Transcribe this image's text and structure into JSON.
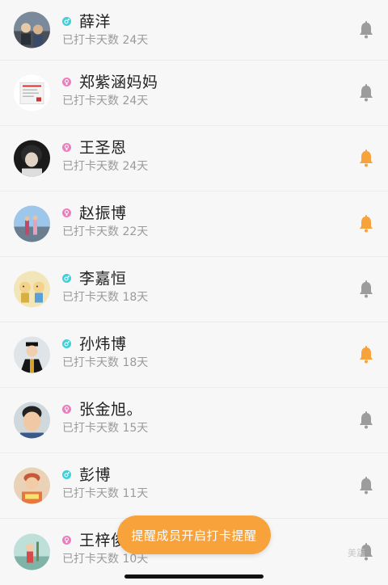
{
  "colors": {
    "accent": "#f7a23a",
    "bell_active": "#f7a23a",
    "bell_inactive": "#9c9c9c",
    "gender_male": "#3fd0d9",
    "gender_female": "#ee7dc0"
  },
  "members": [
    {
      "name": "薛洋",
      "days": "已打卡天数 24天",
      "gender": "male",
      "bell": "inactive"
    },
    {
      "name": "郑紫涵妈妈",
      "days": "已打卡天数 24天",
      "gender": "female",
      "bell": "inactive"
    },
    {
      "name": "王圣恩",
      "days": "已打卡天数 24天",
      "gender": "female",
      "bell": "active"
    },
    {
      "name": "赵振博",
      "days": "已打卡天数 22天",
      "gender": "female",
      "bell": "active"
    },
    {
      "name": "李嘉恒",
      "days": "已打卡天数 18天",
      "gender": "male",
      "bell": "inactive"
    },
    {
      "name": "孙炜博",
      "days": "已打卡天数 18天",
      "gender": "male",
      "bell": "active"
    },
    {
      "name": "张金旭。",
      "days": "已打卡天数 15天",
      "gender": "female",
      "bell": "inactive"
    },
    {
      "name": "彭博",
      "days": "已打卡天数 11天",
      "gender": "male",
      "bell": "inactive"
    },
    {
      "name": "王梓俊",
      "days": "已打卡天数 10天",
      "gender": "female",
      "bell": "inactive"
    }
  ],
  "action_button": {
    "label": "提醒成员开启打卡提醒"
  },
  "watermark": {
    "text": "美篇"
  }
}
